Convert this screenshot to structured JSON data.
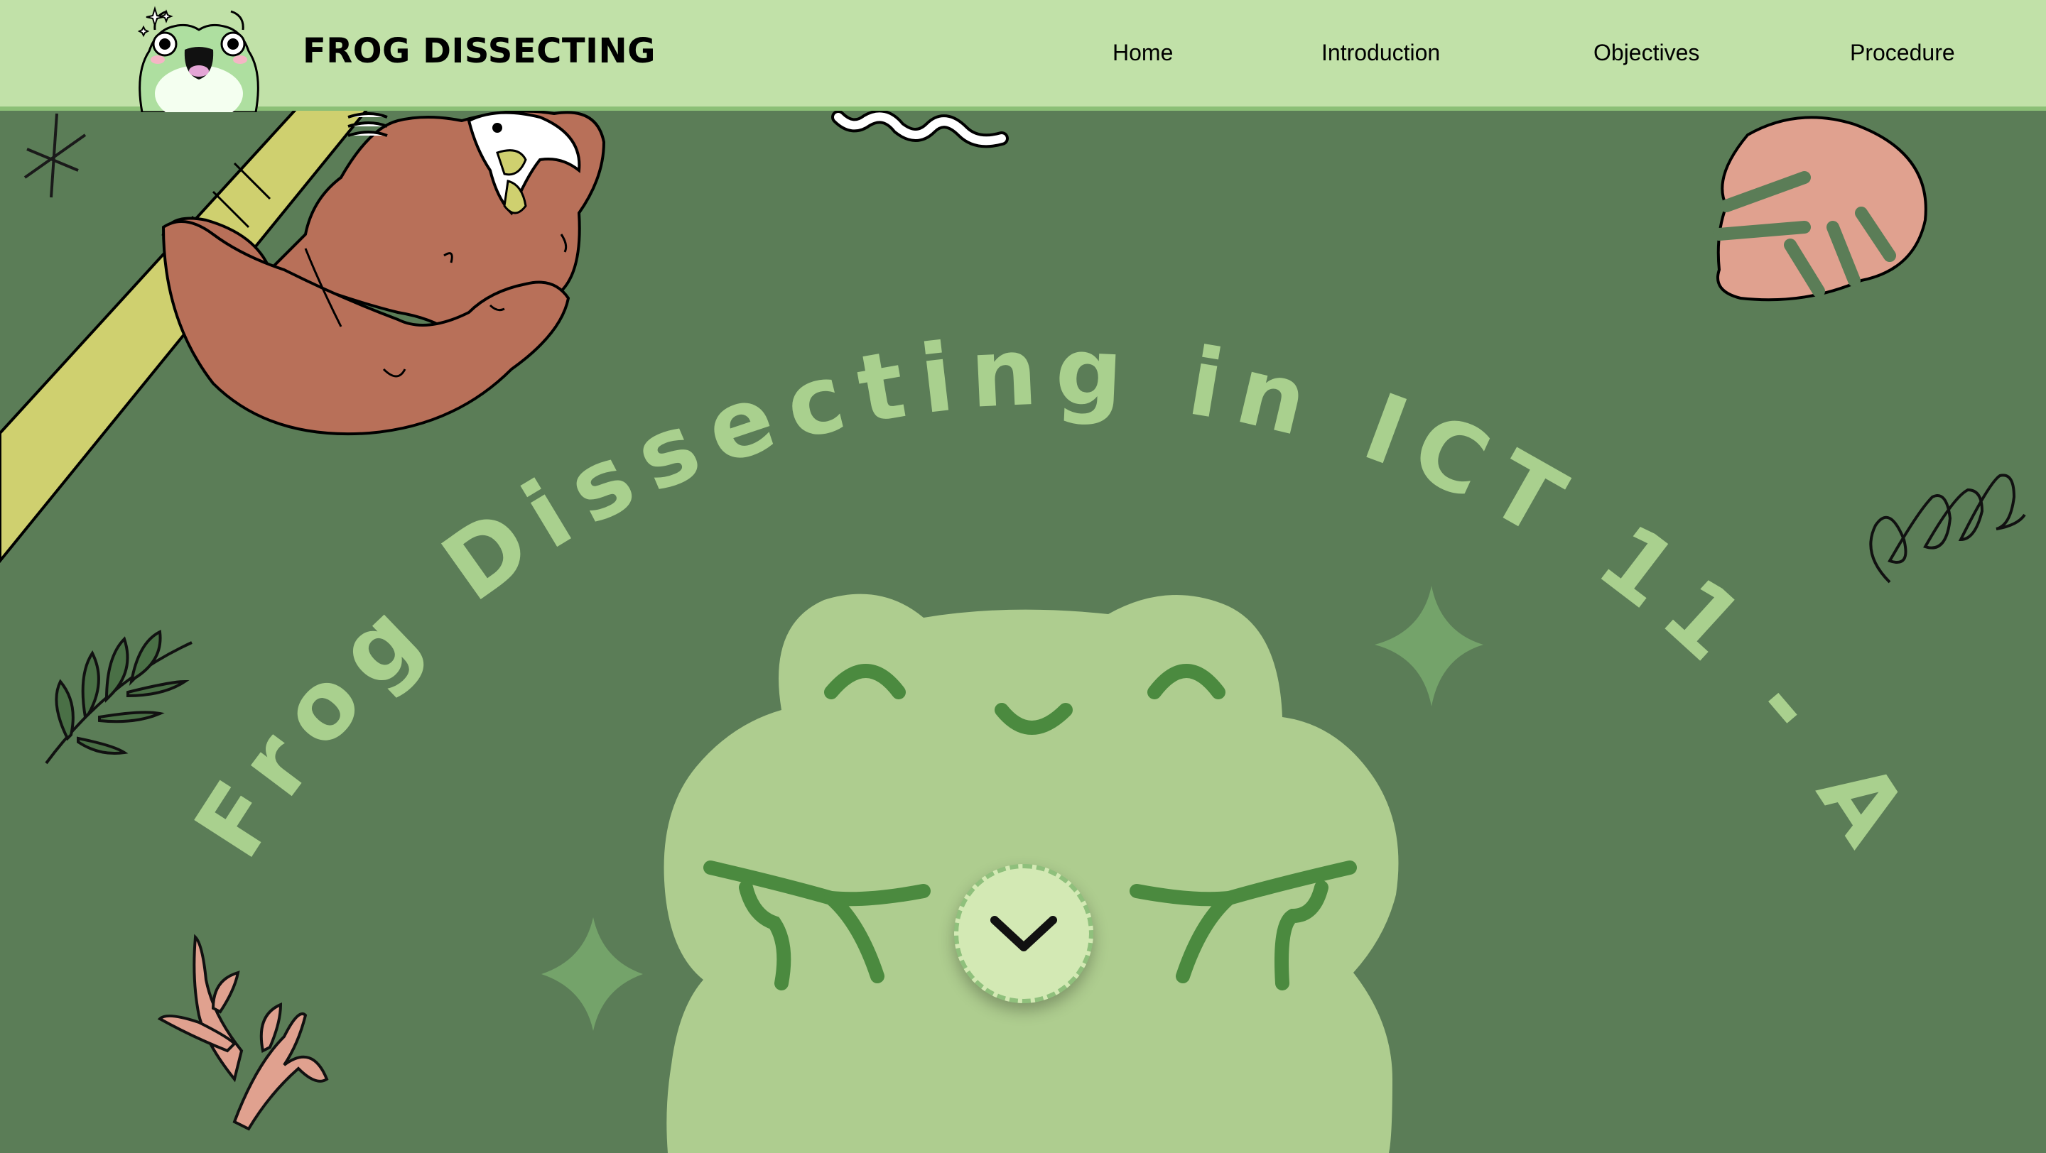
{
  "header": {
    "brand_title": "FROG DISSECTING",
    "nav": [
      {
        "label": "Home"
      },
      {
        "label": "Introduction"
      },
      {
        "label": "Objectives"
      },
      {
        "label": "Procedure"
      }
    ]
  },
  "hero": {
    "title": "Frog Dissecting in ICT 11 - A",
    "scroll_icon": "chevron-down-icon"
  },
  "colors": {
    "header_bg": "#c1e1a8",
    "page_bg": "#5b7d57",
    "title_text": "#a9d08e",
    "frog_body": "#aecd8f",
    "frog_features": "#4b8a3f",
    "sparkle": "#74a36a",
    "sloth": "#b87059",
    "branch": "#cfd06f",
    "monstera_leaf": "#e0a18f"
  }
}
